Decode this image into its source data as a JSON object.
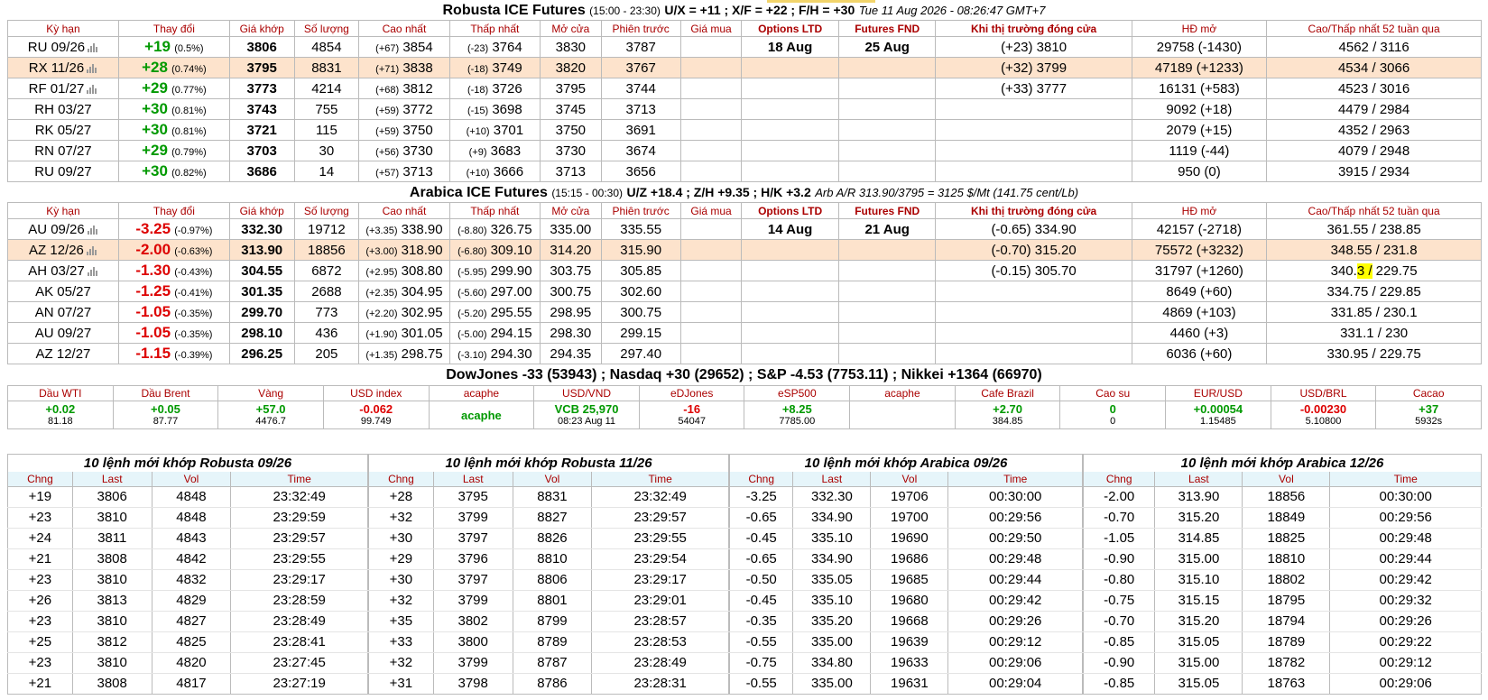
{
  "robusta": {
    "title": "Robusta ICE Futures",
    "hours": "(15:00 - 23:30)",
    "spreads": "U/X = +11 ; X/F = +22 ; F/H = +30",
    "timestamp": "Tue 11 Aug 2026 - 08:26:47 GMT+7",
    "headers": [
      "Kỳ hạn",
      "Thay đổi",
      "Giá khớp",
      "Số lượng",
      "Cao nhất",
      "Thấp nhất",
      "Mở cửa",
      "Phiên trước",
      "Giá mua",
      "Options LTD",
      "Futures FND",
      "Khi thị trường đóng cửa",
      "HĐ mở",
      "Cao/Thấp nhất 52 tuần qua"
    ],
    "rows": [
      {
        "term": "RU 09/26",
        "chart": true,
        "chg": "+19",
        "pct": "(0.5%)",
        "last": "3806",
        "vol": "4854",
        "hi_d": "(+67)",
        "hi": "3854",
        "lo_d": "(-23)",
        "lo": "3764",
        "open": "3830",
        "prev": "3787",
        "bid": "",
        "opt": "18 Aug",
        "fnd": "25 Aug",
        "close": "(+23) 3810",
        "oi": "29758 (-1430)",
        "hl52": "4562 / 3116",
        "hilite": false
      },
      {
        "term": "RX 11/26",
        "chart": true,
        "chg": "+28",
        "pct": "(0.74%)",
        "last": "3795",
        "vol": "8831",
        "hi_d": "(+71)",
        "hi": "3838",
        "lo_d": "(-18)",
        "lo": "3749",
        "open": "3820",
        "prev": "3767",
        "bid": "",
        "opt": "",
        "fnd": "",
        "close": "(+32) 3799",
        "oi": "47189 (+1233)",
        "hl52": "4534 / 3066",
        "hilite": true
      },
      {
        "term": "RF 01/27",
        "chart": true,
        "chg": "+29",
        "pct": "(0.77%)",
        "last": "3773",
        "vol": "4214",
        "hi_d": "(+68)",
        "hi": "3812",
        "lo_d": "(-18)",
        "lo": "3726",
        "open": "3795",
        "prev": "3744",
        "bid": "",
        "opt": "",
        "fnd": "",
        "close": "(+33) 3777",
        "oi": "16131 (+583)",
        "hl52": "4523 / 3016",
        "hilite": false
      },
      {
        "term": "RH 03/27",
        "chart": false,
        "chg": "+30",
        "pct": "(0.81%)",
        "last": "3743",
        "vol": "755",
        "hi_d": "(+59)",
        "hi": "3772",
        "lo_d": "(-15)",
        "lo": "3698",
        "open": "3745",
        "prev": "3713",
        "bid": "",
        "opt": "",
        "fnd": "",
        "close": "",
        "oi": "9092 (+18)",
        "hl52": "4479 / 2984",
        "hilite": false
      },
      {
        "term": "RK 05/27",
        "chart": false,
        "chg": "+30",
        "pct": "(0.81%)",
        "last": "3721",
        "vol": "115",
        "hi_d": "(+59)",
        "hi": "3750",
        "lo_d": "(+10)",
        "lo": "3701",
        "open": "3750",
        "prev": "3691",
        "bid": "",
        "opt": "",
        "fnd": "",
        "close": "",
        "oi": "2079 (+15)",
        "hl52": "4352 / 2963",
        "hilite": false
      },
      {
        "term": "RN 07/27",
        "chart": false,
        "chg": "+29",
        "pct": "(0.79%)",
        "last": "3703",
        "vol": "30",
        "hi_d": "(+56)",
        "hi": "3730",
        "lo_d": "(+9)",
        "lo": "3683",
        "open": "3730",
        "prev": "3674",
        "bid": "",
        "opt": "",
        "fnd": "",
        "close": "",
        "oi": "1119 (-44)",
        "hl52": "4079 / 2948",
        "hilite": false
      },
      {
        "term": "RU 09/27",
        "chart": false,
        "chg": "+30",
        "pct": "(0.82%)",
        "last": "3686",
        "vol": "14",
        "hi_d": "(+57)",
        "hi": "3713",
        "lo_d": "(+10)",
        "lo": "3666",
        "open": "3713",
        "prev": "3656",
        "bid": "",
        "opt": "",
        "fnd": "",
        "close": "",
        "oi": "950 (0)",
        "hl52": "3915 / 2934",
        "hilite": false
      }
    ]
  },
  "arabica": {
    "title": "Arabica ICE Futures",
    "hours": "(15:15 - 00:30)",
    "spreads": "U/Z +18.4 ; Z/H +9.35 ; H/K +3.2",
    "arb": "Arb A/R 313.90/3795 = 3125 $/Mt (141.75 cent/Lb)",
    "headers": [
      "Kỳ hạn",
      "Thay đổi",
      "Giá khớp",
      "Số lượng",
      "Cao nhất",
      "Thấp nhất",
      "Mở cửa",
      "Phiên trước",
      "Giá mua",
      "Options LTD",
      "Futures FND",
      "Khi thị trường đóng cửa",
      "HĐ mở",
      "Cao/Thấp nhất 52 tuần qua"
    ],
    "rows": [
      {
        "term": "AU 09/26",
        "chart": true,
        "chg": "-3.25",
        "pct": "(-0.97%)",
        "last": "332.30",
        "vol": "19712",
        "hi_d": "(+3.35)",
        "hi": "338.90",
        "lo_d": "(-8.80)",
        "lo": "326.75",
        "open": "335.00",
        "prev": "335.55",
        "bid": "",
        "opt": "14 Aug",
        "fnd": "21 Aug",
        "close": "(-0.65) 334.90",
        "oi": "42157 (-2718)",
        "hl52": "361.55 / 238.85",
        "hilite": false
      },
      {
        "term": "AZ 12/26",
        "chart": true,
        "chg": "-2.00",
        "pct": "(-0.63%)",
        "last": "313.90",
        "vol": "18856",
        "hi_d": "(+3.00)",
        "hi": "318.90",
        "lo_d": "(-6.80)",
        "lo": "309.10",
        "open": "314.20",
        "prev": "315.90",
        "bid": "",
        "opt": "",
        "fnd": "",
        "close": "(-0.70) 315.20",
        "oi": "75572 (+3232)",
        "hl52": "348.55 / 231.8",
        "hilite": true
      },
      {
        "term": "AH 03/27",
        "chart": true,
        "chg": "-1.30",
        "pct": "(-0.43%)",
        "last": "304.55",
        "vol": "6872",
        "hi_d": "(+2.95)",
        "hi": "308.80",
        "lo_d": "(-5.95)",
        "lo": "299.90",
        "open": "303.75",
        "prev": "305.85",
        "bid": "",
        "opt": "",
        "fnd": "",
        "close": "(-0.15) 305.70",
        "oi": "31797 (+1260)",
        "hl52": "340.3 / 229.75",
        "hilite": false
      },
      {
        "term": "AK 05/27",
        "chart": false,
        "chg": "-1.25",
        "pct": "(-0.41%)",
        "last": "301.35",
        "vol": "2688",
        "hi_d": "(+2.35)",
        "hi": "304.95",
        "lo_d": "(-5.60)",
        "lo": "297.00",
        "open": "300.75",
        "prev": "302.60",
        "bid": "",
        "opt": "",
        "fnd": "",
        "close": "",
        "oi": "8649 (+60)",
        "hl52": "334.75 / 229.85",
        "hilite": false
      },
      {
        "term": "AN 07/27",
        "chart": false,
        "chg": "-1.05",
        "pct": "(-0.35%)",
        "last": "299.70",
        "vol": "773",
        "hi_d": "(+2.20)",
        "hi": "302.95",
        "lo_d": "(-5.20)",
        "lo": "295.55",
        "open": "298.95",
        "prev": "300.75",
        "bid": "",
        "opt": "",
        "fnd": "",
        "close": "",
        "oi": "4869 (+103)",
        "hl52": "331.85 / 230.1",
        "hilite": false
      },
      {
        "term": "AU 09/27",
        "chart": false,
        "chg": "-1.05",
        "pct": "(-0.35%)",
        "last": "298.10",
        "vol": "436",
        "hi_d": "(+1.90)",
        "hi": "301.05",
        "lo_d": "(-5.00)",
        "lo": "294.15",
        "open": "298.30",
        "prev": "299.15",
        "bid": "",
        "opt": "",
        "fnd": "",
        "close": "",
        "oi": "4460 (+3)",
        "hl52": "331.1 / 230",
        "hilite": false
      },
      {
        "term": "AZ 12/27",
        "chart": false,
        "chg": "-1.15",
        "pct": "(-0.39%)",
        "last": "296.25",
        "vol": "205",
        "hi_d": "(+1.35)",
        "hi": "298.75",
        "lo_d": "(-3.10)",
        "lo": "294.30",
        "open": "294.35",
        "prev": "297.40",
        "bid": "",
        "opt": "",
        "fnd": "",
        "close": "",
        "oi": "6036 (+60)",
        "hl52": "330.95 / 229.75",
        "hilite": false
      }
    ]
  },
  "indices_title": "DowJones -33 (53943) ; Nasdaq +30 (29652) ; S&P -4.53 (7753.11) ; Nikkei +1364 (66970)",
  "markets": {
    "headers": [
      "Dầu WTI",
      "Dầu Brent",
      "Vàng",
      "USD index",
      "acaphe",
      "USD/VND",
      "eDJones",
      "eSP500",
      "acaphe",
      "Cafe Brazil",
      "Cao su",
      "EUR/USD",
      "USD/BRL",
      "Cacao"
    ],
    "cells": [
      {
        "v1": "+0.02",
        "v2": "81.18",
        "dir": "up"
      },
      {
        "v1": "+0.05",
        "v2": "87.77",
        "dir": "up"
      },
      {
        "v1": "+57.0",
        "v2": "4476.7",
        "dir": "up"
      },
      {
        "v1": "-0.062",
        "v2": "99.749",
        "dir": "down"
      },
      {
        "v1": "acaphe",
        "v2": "",
        "dir": "brand"
      },
      {
        "v1": "VCB 25,970",
        "v2": "08:23 Aug 11",
        "dir": "up"
      },
      {
        "v1": "-16",
        "v2": "54047",
        "dir": "down"
      },
      {
        "v1": "+8.25",
        "v2": "7785.00",
        "dir": "up"
      },
      {
        "v1": "",
        "v2": "",
        "dir": "none"
      },
      {
        "v1": "+2.70",
        "v2": "384.85",
        "dir": "up"
      },
      {
        "v1": "0",
        "v2": "0",
        "dir": "up"
      },
      {
        "v1": "+0.00054",
        "v2": "1.15485",
        "dir": "up"
      },
      {
        "v1": "-0.00230",
        "v2": "5.10800",
        "dir": "down"
      },
      {
        "v1": "+37",
        "v2": "5932s",
        "dir": "up"
      }
    ]
  },
  "trades": {
    "headers": [
      "Chng",
      "Last",
      "Vol",
      "Time"
    ],
    "panels": [
      {
        "title": "10 lệnh mới khớp Robusta 09/26",
        "rows": [
          [
            "+19",
            "3806",
            "4848",
            "23:32:49"
          ],
          [
            "+23",
            "3810",
            "4848",
            "23:29:59"
          ],
          [
            "+24",
            "3811",
            "4843",
            "23:29:57"
          ],
          [
            "+21",
            "3808",
            "4842",
            "23:29:55"
          ],
          [
            "+23",
            "3810",
            "4832",
            "23:29:17"
          ],
          [
            "+26",
            "3813",
            "4829",
            "23:28:59"
          ],
          [
            "+23",
            "3810",
            "4827",
            "23:28:49"
          ],
          [
            "+25",
            "3812",
            "4825",
            "23:28:41"
          ],
          [
            "+23",
            "3810",
            "4820",
            "23:27:45"
          ],
          [
            "+21",
            "3808",
            "4817",
            "23:27:19"
          ]
        ]
      },
      {
        "title": "10 lệnh mới khớp Robusta 11/26",
        "rows": [
          [
            "+28",
            "3795",
            "8831",
            "23:32:49"
          ],
          [
            "+32",
            "3799",
            "8827",
            "23:29:57"
          ],
          [
            "+30",
            "3797",
            "8826",
            "23:29:55"
          ],
          [
            "+29",
            "3796",
            "8810",
            "23:29:54"
          ],
          [
            "+30",
            "3797",
            "8806",
            "23:29:17"
          ],
          [
            "+32",
            "3799",
            "8801",
            "23:29:01"
          ],
          [
            "+35",
            "3802",
            "8799",
            "23:28:57"
          ],
          [
            "+33",
            "3800",
            "8789",
            "23:28:53"
          ],
          [
            "+32",
            "3799",
            "8787",
            "23:28:49"
          ],
          [
            "+31",
            "3798",
            "8786",
            "23:28:31"
          ]
        ]
      },
      {
        "title": "10 lệnh mới khớp Arabica 09/26",
        "rows": [
          [
            "-3.25",
            "332.30",
            "19706",
            "00:30:00"
          ],
          [
            "-0.65",
            "334.90",
            "19700",
            "00:29:56"
          ],
          [
            "-0.45",
            "335.10",
            "19690",
            "00:29:50"
          ],
          [
            "-0.65",
            "334.90",
            "19686",
            "00:29:48"
          ],
          [
            "-0.50",
            "335.05",
            "19685",
            "00:29:44"
          ],
          [
            "-0.45",
            "335.10",
            "19680",
            "00:29:42"
          ],
          [
            "-0.35",
            "335.20",
            "19668",
            "00:29:26"
          ],
          [
            "-0.55",
            "335.00",
            "19639",
            "00:29:12"
          ],
          [
            "-0.75",
            "334.80",
            "19633",
            "00:29:06"
          ],
          [
            "-0.55",
            "335.00",
            "19631",
            "00:29:04"
          ]
        ]
      },
      {
        "title": "10 lệnh mới khớp Arabica 12/26",
        "rows": [
          [
            "-2.00",
            "313.90",
            "18856",
            "00:30:00"
          ],
          [
            "-0.70",
            "315.20",
            "18849",
            "00:29:56"
          ],
          [
            "-1.05",
            "314.85",
            "18825",
            "00:29:48"
          ],
          [
            "-0.90",
            "315.00",
            "18810",
            "00:29:44"
          ],
          [
            "-0.80",
            "315.10",
            "18802",
            "00:29:42"
          ],
          [
            "-0.75",
            "315.15",
            "18795",
            "00:29:32"
          ],
          [
            "-0.70",
            "315.20",
            "18794",
            "00:29:26"
          ],
          [
            "-0.85",
            "315.05",
            "18789",
            "00:29:22"
          ],
          [
            "-0.90",
            "315.00",
            "18782",
            "00:29:12"
          ],
          [
            "-0.85",
            "315.05",
            "18763",
            "00:29:06"
          ]
        ]
      }
    ]
  },
  "colors": {
    "up": "#009900",
    "down": "#dd0000",
    "header_text": "#aa0000",
    "row_hilite": "#fde3cc",
    "trade_header_bg": "#e6f5fa"
  }
}
